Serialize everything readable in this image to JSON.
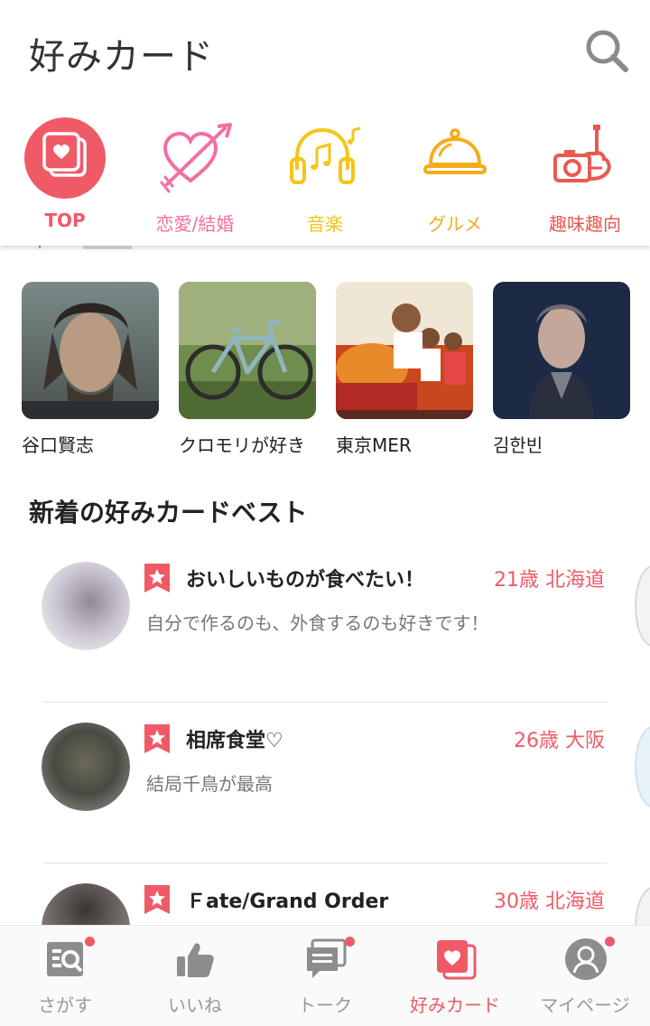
{
  "header": {
    "title": "好みカード",
    "search_icon": "search-icon"
  },
  "categories": [
    {
      "label": "TOP",
      "color": "#f05a67",
      "icon": "card-heart-icon"
    },
    {
      "label": "恋愛/結婚",
      "color": "#f36ea3",
      "icon": "heart-arrow-icon"
    },
    {
      "label": "音楽",
      "color": "#f5c518",
      "icon": "headphones-icon"
    },
    {
      "label": "グルメ",
      "color": "#f5ac1b",
      "icon": "cloche-icon"
    },
    {
      "label": "趣味趣向",
      "color": "#ea5a4f",
      "icon": "camera-guitar-icon"
    }
  ],
  "recommended": [
    {
      "name": "谷口賢志"
    },
    {
      "name": "クロモリが好き"
    },
    {
      "name": "東京MER"
    },
    {
      "name": "김한빈"
    }
  ],
  "best": {
    "title": "新着の好みカードベスト",
    "items": [
      {
        "title": "おいしいものが食べたい！",
        "meta": "21歳 北海道",
        "text": "自分で作るのも、外食するのも好きです！"
      },
      {
        "title": "相席食堂♡",
        "meta": "26歳 大阪",
        "text": "結局千鳥が最高"
      },
      {
        "title": "Ｆate/Grand Order",
        "meta": "30歳 北海道",
        "text": ""
      }
    ]
  },
  "bottom_nav": [
    {
      "label": "さがす",
      "icon": "search-list-icon",
      "badge": true,
      "active": false
    },
    {
      "label": "いいね",
      "icon": "thumbs-up-icon",
      "badge": false,
      "active": false
    },
    {
      "label": "トーク",
      "icon": "chat-icon",
      "badge": true,
      "active": false
    },
    {
      "label": "好みカード",
      "icon": "card-heart-icon",
      "badge": false,
      "active": true
    },
    {
      "label": "マイページ",
      "icon": "profile-icon",
      "badge": true,
      "active": false
    }
  ],
  "colors": {
    "accent": "#f05a67",
    "muted": "#9a9a9a"
  }
}
